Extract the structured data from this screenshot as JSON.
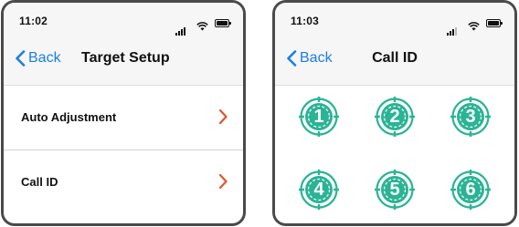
{
  "colors": {
    "accent": "#1a7de8",
    "chevron": "#e0552b",
    "target": "#2bb395"
  },
  "screen1": {
    "status_time": "11:02",
    "back_label": "Back",
    "title": "Target Setup",
    "rows": [
      {
        "label": "Auto Adjustment",
        "icon": "chevron-right-icon"
      },
      {
        "label": "Call ID",
        "icon": "chevron-right-icon"
      }
    ]
  },
  "screen2": {
    "status_time": "11:03",
    "back_label": "Back",
    "title": "Call ID",
    "targets": [
      {
        "label": "1"
      },
      {
        "label": "2"
      },
      {
        "label": "3"
      },
      {
        "label": "4"
      },
      {
        "label": "5"
      },
      {
        "label": "6"
      }
    ]
  }
}
